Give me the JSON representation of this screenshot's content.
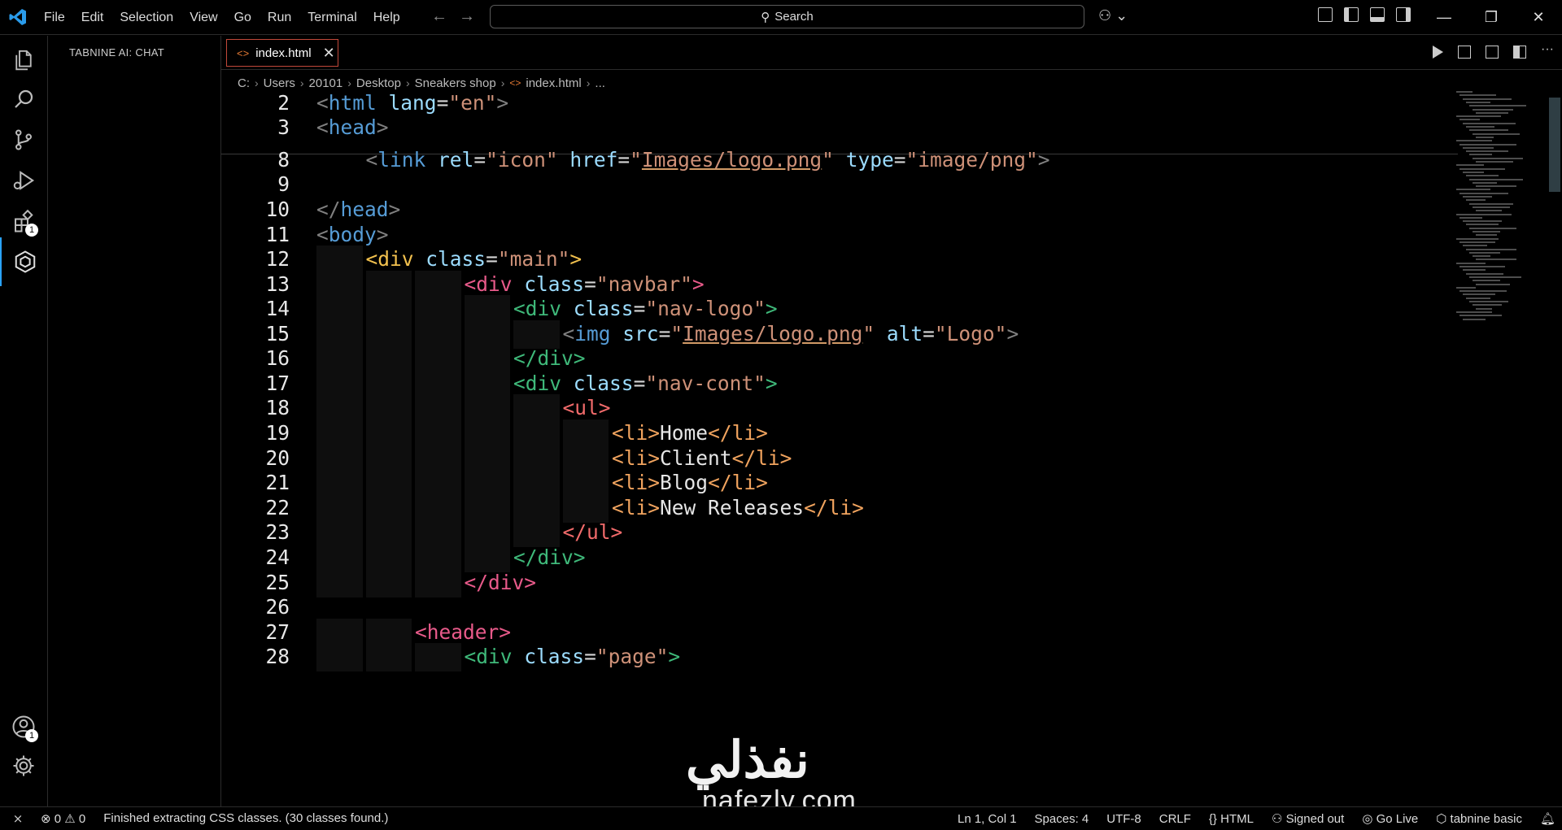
{
  "menu": [
    "File",
    "Edit",
    "Selection",
    "View",
    "Go",
    "Run",
    "Terminal",
    "Help"
  ],
  "search": {
    "label": "Search"
  },
  "sidebar": {
    "title": "TABNINE AI: CHAT"
  },
  "activity_badges": {
    "extensions": "1",
    "accounts": "1"
  },
  "tab": {
    "label": "index.html",
    "close": "✕"
  },
  "breadcrumb": [
    "C:",
    "Users",
    "20101",
    "Desktop",
    "Sneakers shop",
    "index.html",
    "..."
  ],
  "lines": [
    {
      "n": "2",
      "tokens": [
        [
          "br",
          "<"
        ],
        [
          "tag",
          "html"
        ],
        [
          "txt",
          " "
        ],
        [
          "attr",
          "lang"
        ],
        [
          "eq",
          "="
        ],
        [
          "str",
          "\"en\""
        ],
        [
          "br",
          ">"
        ]
      ]
    },
    {
      "n": "3",
      "tokens": [
        [
          "br",
          "<"
        ],
        [
          "tag",
          "head"
        ],
        [
          "br",
          ">"
        ]
      ]
    },
    {
      "n": "8",
      "tokens": [
        [
          "br",
          "<"
        ],
        [
          "tag",
          "link"
        ],
        [
          "txt",
          " "
        ],
        [
          "attr",
          "rel"
        ],
        [
          "eq",
          "="
        ],
        [
          "str",
          "\"icon\""
        ],
        [
          "txt",
          " "
        ],
        [
          "attr",
          "href"
        ],
        [
          "eq",
          "="
        ],
        [
          "str",
          "\""
        ],
        [
          "link",
          "Images/logo.png"
        ],
        [
          "str",
          "\""
        ],
        [
          "txt",
          " "
        ],
        [
          "attr",
          "type"
        ],
        [
          "eq",
          "="
        ],
        [
          "str",
          "\"image/png\""
        ],
        [
          "br",
          ">"
        ]
      ]
    },
    {
      "n": "9",
      "tokens": []
    },
    {
      "n": "10",
      "tokens": [
        [
          "br",
          "</"
        ],
        [
          "tag",
          "head"
        ],
        [
          "br",
          ">"
        ]
      ]
    },
    {
      "n": "11",
      "tokens": [
        [
          "br",
          "<"
        ],
        [
          "tag",
          "body"
        ],
        [
          "br",
          ">"
        ]
      ]
    },
    {
      "n": "12",
      "tokens": [
        [
          "y",
          "<"
        ],
        [
          "y",
          "div"
        ],
        [
          "txt",
          " "
        ],
        [
          "attr",
          "class"
        ],
        [
          "eq",
          "="
        ],
        [
          "str",
          "\"main\""
        ],
        [
          "y",
          ">"
        ]
      ]
    },
    {
      "n": "13",
      "tokens": [
        [
          "p",
          "<"
        ],
        [
          "p",
          "div"
        ],
        [
          "txt",
          " "
        ],
        [
          "attr",
          "class"
        ],
        [
          "eq",
          "="
        ],
        [
          "str",
          "\"navbar\""
        ],
        [
          "p",
          ">"
        ]
      ]
    },
    {
      "n": "14",
      "tokens": [
        [
          "g",
          "<"
        ],
        [
          "g",
          "div"
        ],
        [
          "txt",
          " "
        ],
        [
          "attr",
          "class"
        ],
        [
          "eq",
          "="
        ],
        [
          "str",
          "\"nav-logo\""
        ],
        [
          "g",
          ">"
        ]
      ]
    },
    {
      "n": "15",
      "tokens": [
        [
          "br",
          "<"
        ],
        [
          "tag",
          "img"
        ],
        [
          "txt",
          " "
        ],
        [
          "attr",
          "src"
        ],
        [
          "eq",
          "="
        ],
        [
          "str",
          "\""
        ],
        [
          "link",
          "Images/logo.png"
        ],
        [
          "str",
          "\""
        ],
        [
          "txt",
          " "
        ],
        [
          "attr",
          "alt"
        ],
        [
          "eq",
          "="
        ],
        [
          "str",
          "\"Logo\""
        ],
        [
          "br",
          ">"
        ]
      ]
    },
    {
      "n": "16",
      "tokens": [
        [
          "g",
          "</"
        ],
        [
          "g",
          "div"
        ],
        [
          "g",
          ">"
        ]
      ]
    },
    {
      "n": "17",
      "tokens": [
        [
          "g",
          "<"
        ],
        [
          "g",
          "div"
        ],
        [
          "txt",
          " "
        ],
        [
          "attr",
          "class"
        ],
        [
          "eq",
          "="
        ],
        [
          "str",
          "\"nav-cont\""
        ],
        [
          "g",
          ">"
        ]
      ]
    },
    {
      "n": "18",
      "tokens": [
        [
          "r",
          "<"
        ],
        [
          "r",
          "ul"
        ],
        [
          "r",
          ">"
        ]
      ]
    },
    {
      "n": "19",
      "tokens": [
        [
          "o",
          "<"
        ],
        [
          "o",
          "li"
        ],
        [
          "o",
          ">"
        ],
        [
          "txt",
          "Home"
        ],
        [
          "o",
          "</"
        ],
        [
          "o",
          "li"
        ],
        [
          "o",
          ">"
        ]
      ]
    },
    {
      "n": "20",
      "tokens": [
        [
          "o",
          "<"
        ],
        [
          "o",
          "li"
        ],
        [
          "o",
          ">"
        ],
        [
          "txt",
          "Client"
        ],
        [
          "o",
          "</"
        ],
        [
          "o",
          "li"
        ],
        [
          "o",
          ">"
        ]
      ]
    },
    {
      "n": "21",
      "tokens": [
        [
          "o",
          "<"
        ],
        [
          "o",
          "li"
        ],
        [
          "o",
          ">"
        ],
        [
          "txt",
          "Blog"
        ],
        [
          "o",
          "</"
        ],
        [
          "o",
          "li"
        ],
        [
          "o",
          ">"
        ]
      ]
    },
    {
      "n": "22",
      "tokens": [
        [
          "o",
          "<"
        ],
        [
          "o",
          "li"
        ],
        [
          "o",
          ">"
        ],
        [
          "txt",
          "New Releases"
        ],
        [
          "o",
          "</"
        ],
        [
          "o",
          "li"
        ],
        [
          "o",
          ">"
        ]
      ]
    },
    {
      "n": "23",
      "tokens": [
        [
          "r",
          "</"
        ],
        [
          "r",
          "ul"
        ],
        [
          "r",
          ">"
        ]
      ]
    },
    {
      "n": "24",
      "tokens": [
        [
          "g",
          "</"
        ],
        [
          "g",
          "div"
        ],
        [
          "g",
          ">"
        ]
      ]
    },
    {
      "n": "25",
      "tokens": [
        [
          "p",
          "</"
        ],
        [
          "p",
          "div"
        ],
        [
          "p",
          ">"
        ]
      ]
    },
    {
      "n": "26",
      "tokens": []
    },
    {
      "n": "27",
      "tokens": [
        [
          "p",
          "<"
        ],
        [
          "p",
          "header"
        ],
        [
          "p",
          ">"
        ]
      ]
    },
    {
      "n": "28",
      "tokens": [
        [
          "g",
          "<"
        ],
        [
          "g",
          "div"
        ],
        [
          "txt",
          " "
        ],
        [
          "attr",
          "class"
        ],
        [
          "eq",
          "="
        ],
        [
          "str",
          "\"page\""
        ],
        [
          "g",
          ">"
        ]
      ]
    }
  ],
  "status": {
    "errors": "0",
    "warnings": "0",
    "message": "Finished extracting CSS classes. (30 classes found.)",
    "position": "Ln 1, Col 1",
    "spaces": "Spaces: 4",
    "encoding": "UTF-8",
    "eol": "CRLF",
    "language": "HTML",
    "account": "Signed out",
    "golive": "Go Live",
    "tabnine": "tabnine basic"
  },
  "watermark": {
    "arabic": "نفذلي",
    "latin": "nafezly.com"
  },
  "colors": {
    "accent": "#2aa3ff",
    "tab_border": "#c2493a",
    "string": "#ce9178",
    "tag": "#569cd6"
  }
}
